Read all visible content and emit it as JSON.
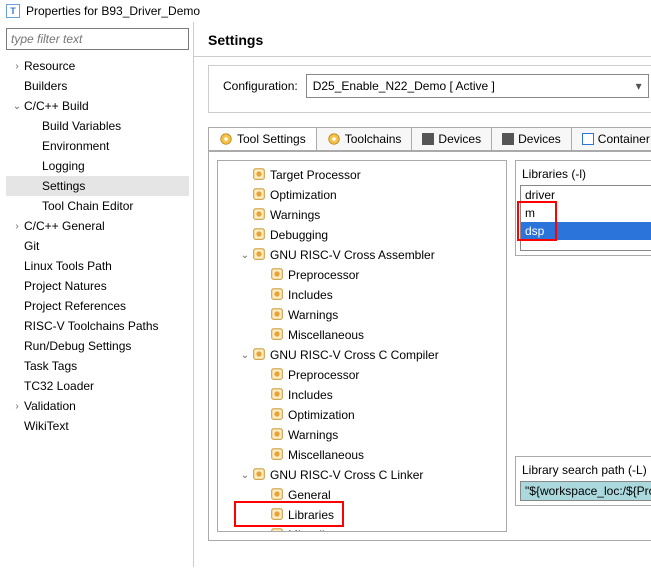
{
  "window": {
    "title": "Properties for B93_Driver_Demo"
  },
  "filter": {
    "placeholder": "type filter text"
  },
  "leftTree": [
    {
      "label": "Resource",
      "indent": 0,
      "twisty": ">"
    },
    {
      "label": "Builders",
      "indent": 0,
      "twisty": ""
    },
    {
      "label": "C/C++ Build",
      "indent": 0,
      "twisty": "v"
    },
    {
      "label": "Build Variables",
      "indent": 1,
      "twisty": ""
    },
    {
      "label": "Environment",
      "indent": 1,
      "twisty": ""
    },
    {
      "label": "Logging",
      "indent": 1,
      "twisty": ""
    },
    {
      "label": "Settings",
      "indent": 1,
      "twisty": "",
      "selected": true
    },
    {
      "label": "Tool Chain Editor",
      "indent": 1,
      "twisty": ""
    },
    {
      "label": "C/C++ General",
      "indent": 0,
      "twisty": ">"
    },
    {
      "label": "Git",
      "indent": 0,
      "twisty": ""
    },
    {
      "label": "Linux Tools Path",
      "indent": 0,
      "twisty": ""
    },
    {
      "label": "Project Natures",
      "indent": 0,
      "twisty": ""
    },
    {
      "label": "Project References",
      "indent": 0,
      "twisty": ""
    },
    {
      "label": "RISC-V Toolchains Paths",
      "indent": 0,
      "twisty": ""
    },
    {
      "label": "Run/Debug Settings",
      "indent": 0,
      "twisty": ""
    },
    {
      "label": "Task Tags",
      "indent": 0,
      "twisty": ""
    },
    {
      "label": "TC32 Loader",
      "indent": 0,
      "twisty": ""
    },
    {
      "label": "Validation",
      "indent": 0,
      "twisty": ">"
    },
    {
      "label": "WikiText",
      "indent": 0,
      "twisty": ""
    }
  ],
  "settings": {
    "heading": "Settings",
    "configLabel": "Configuration:",
    "configValue": "D25_Enable_N22_Demo  [ Active ]"
  },
  "tabs": [
    {
      "label": "Tool Settings",
      "active": true,
      "icon": "gear"
    },
    {
      "label": "Toolchains",
      "icon": "gear"
    },
    {
      "label": "Devices",
      "icon": "device"
    },
    {
      "label": "Devices",
      "icon": "device"
    },
    {
      "label": "Container S",
      "icon": "container"
    }
  ],
  "toolTree": [
    {
      "label": "Target Processor",
      "lvl": 0,
      "t": ""
    },
    {
      "label": "Optimization",
      "lvl": 0,
      "t": ""
    },
    {
      "label": "Warnings",
      "lvl": 0,
      "t": ""
    },
    {
      "label": "Debugging",
      "lvl": 0,
      "t": ""
    },
    {
      "label": "GNU RISC-V Cross Assembler",
      "lvl": 0,
      "t": "v"
    },
    {
      "label": "Preprocessor",
      "lvl": 1,
      "t": ""
    },
    {
      "label": "Includes",
      "lvl": 1,
      "t": ""
    },
    {
      "label": "Warnings",
      "lvl": 1,
      "t": ""
    },
    {
      "label": "Miscellaneous",
      "lvl": 1,
      "t": ""
    },
    {
      "label": "GNU RISC-V Cross C Compiler",
      "lvl": 0,
      "t": "v"
    },
    {
      "label": "Preprocessor",
      "lvl": 1,
      "t": ""
    },
    {
      "label": "Includes",
      "lvl": 1,
      "t": ""
    },
    {
      "label": "Optimization",
      "lvl": 1,
      "t": ""
    },
    {
      "label": "Warnings",
      "lvl": 1,
      "t": ""
    },
    {
      "label": "Miscellaneous",
      "lvl": 1,
      "t": ""
    },
    {
      "label": "GNU RISC-V Cross C Linker",
      "lvl": 0,
      "t": "v"
    },
    {
      "label": "General",
      "lvl": 1,
      "t": ""
    },
    {
      "label": "Libraries",
      "lvl": 1,
      "t": "",
      "highlight": true
    },
    {
      "label": "Miscellaneous",
      "lvl": 1,
      "t": ""
    }
  ],
  "libraries": {
    "title": "Libraries (-l)",
    "items": [
      {
        "label": "driver"
      },
      {
        "label": "m"
      },
      {
        "label": "dsp",
        "selected": true
      }
    ],
    "searchTitle": "Library search path (-L)",
    "searchPath": "\"${workspace_loc:/${ProjN"
  }
}
